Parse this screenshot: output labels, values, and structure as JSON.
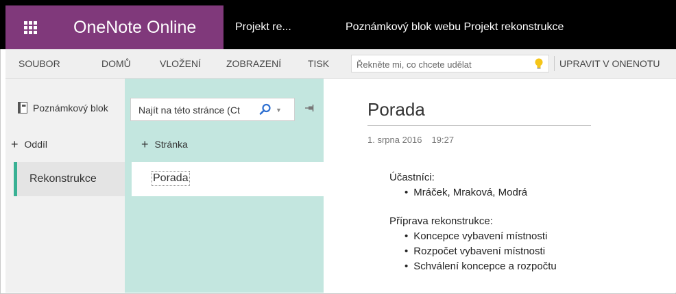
{
  "header": {
    "app_name": "OneNote Online",
    "notebook_short": "Projekt re...",
    "notebook_full": "Poznámkový blok webu Projekt rekonstrukce"
  },
  "ribbon": {
    "tabs": [
      "SOUBOR",
      "DOMŮ",
      "VLOŽENÍ",
      "ZOBRAZENÍ",
      "TISK"
    ],
    "tell_me_placeholder": "Řekněte mi, co chcete udělat",
    "edit_in_onenote": "UPRAVIT V ONENOTU"
  },
  "navigation": {
    "notebooks_label": "Poznámkový blok",
    "add_section": "Oddíl",
    "sections": [
      {
        "label": "Rekonstrukce",
        "color": "#39b194"
      }
    ],
    "search_placeholder": "Najít na této stránce (Ct",
    "add_page": "Stránka",
    "pages": [
      {
        "label": "Porada"
      }
    ]
  },
  "page": {
    "title": "Porada",
    "date": "1. srpna 2016",
    "time": "19:27",
    "blocks": [
      {
        "heading": "Účastníci:",
        "items": [
          "Mráček, Mraková, Modrá"
        ]
      },
      {
        "heading": "Příprava rekonstrukce:",
        "items": [
          "Koncepce vybavení místnosti",
          "Rozpočet vybavení místnosti",
          "Schválení koncepce a rozpočtu"
        ]
      }
    ]
  },
  "colors": {
    "brand": "#80397b",
    "section_accent": "#39b194",
    "pages_pane": "#c3e6df"
  },
  "icons": [
    "app-launcher-icon",
    "notebook-icon",
    "plus-icon",
    "search-icon",
    "chevron-down-icon",
    "pin-icon",
    "lightbulb-icon"
  ]
}
